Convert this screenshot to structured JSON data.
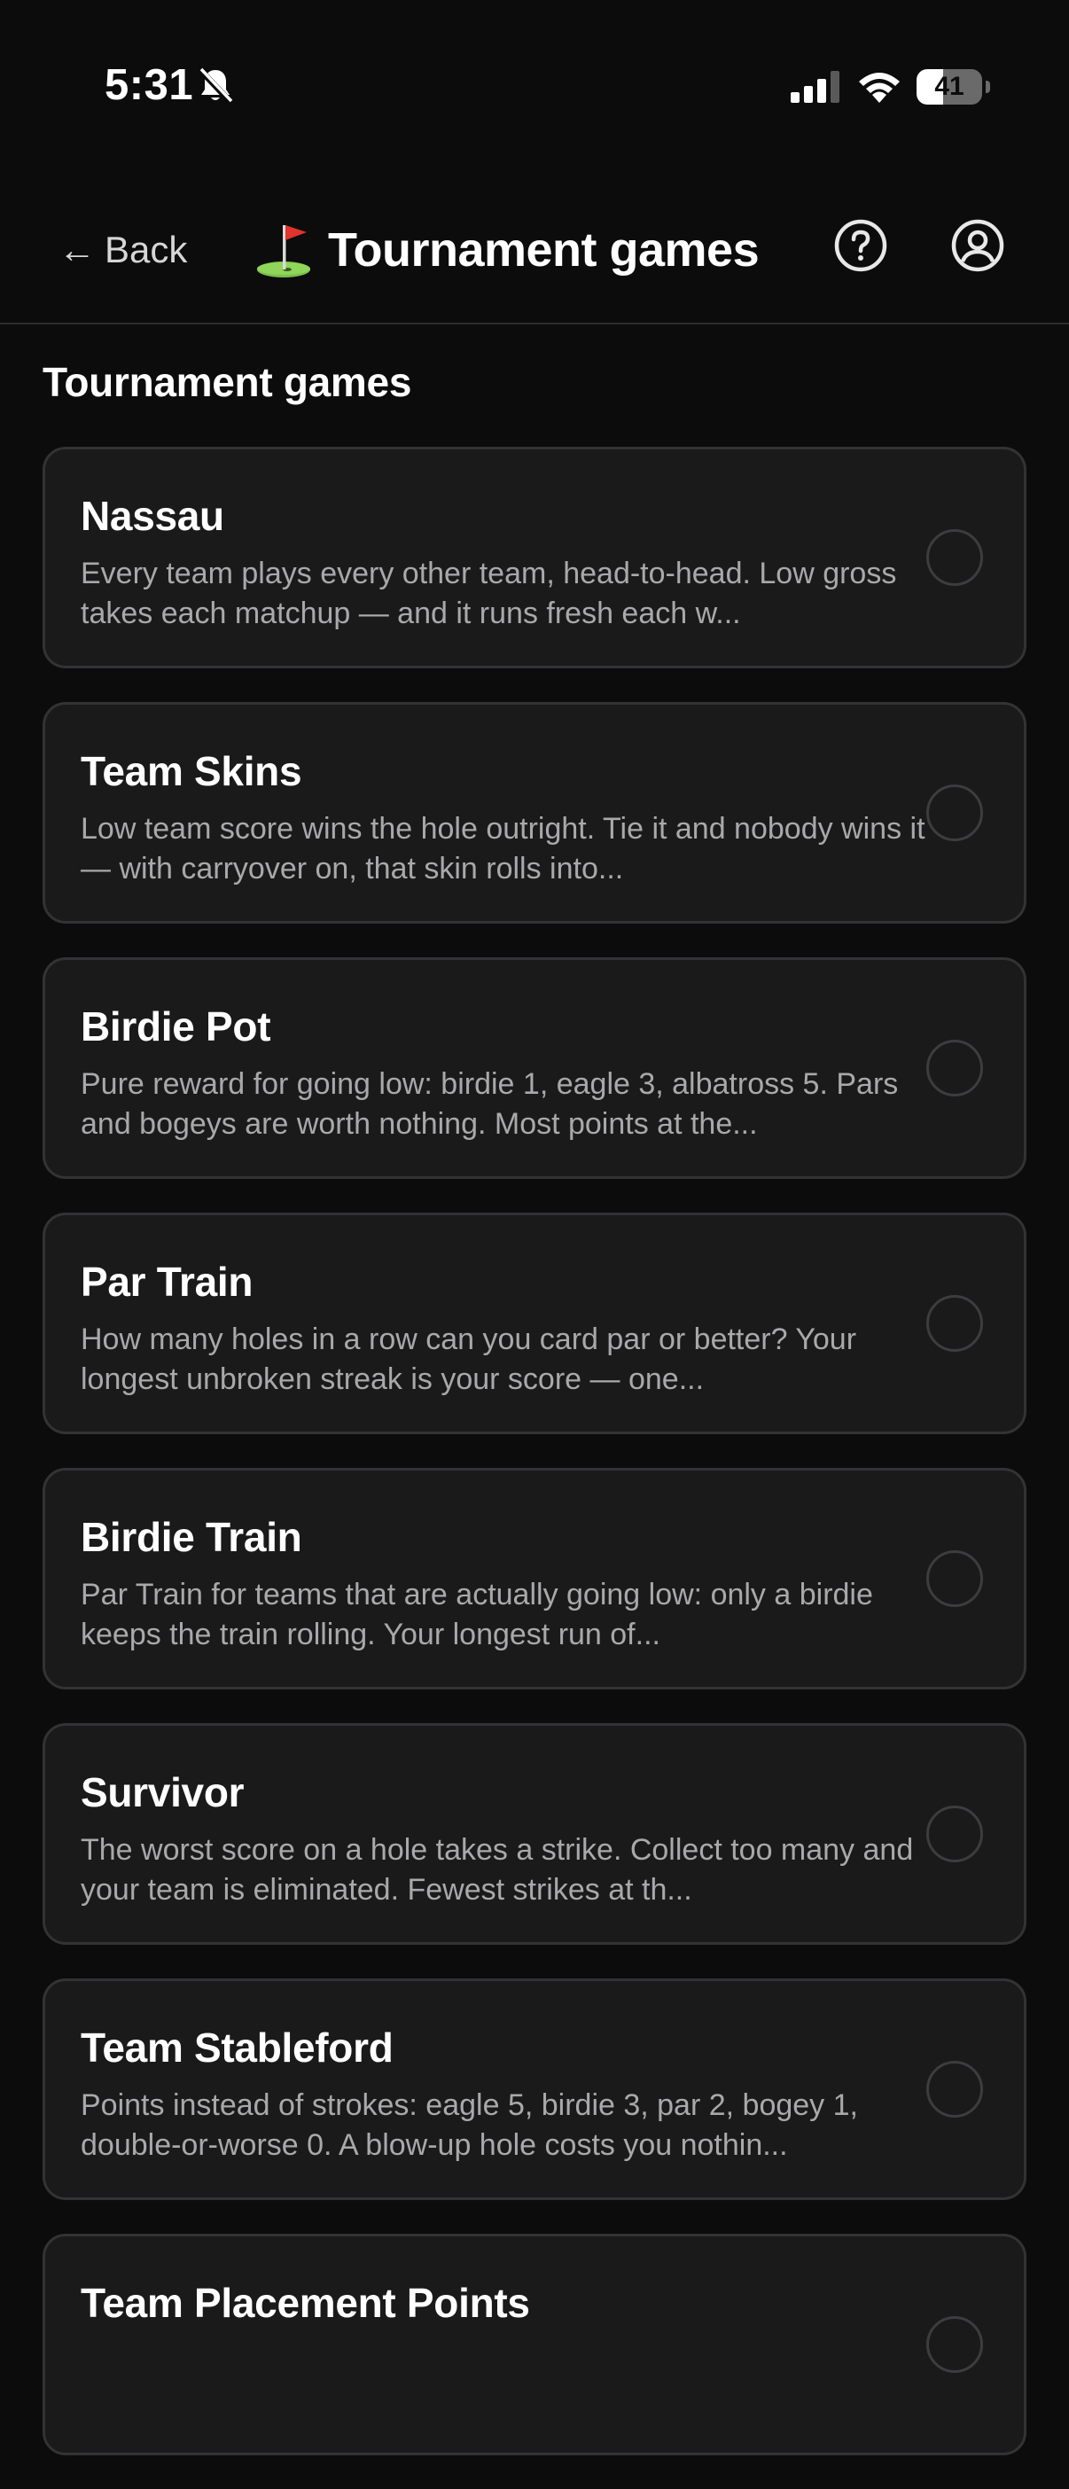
{
  "status_bar": {
    "time": "5:31",
    "battery_level": "41",
    "battery_fraction": 0.41
  },
  "header": {
    "back_label": "Back",
    "back_arrow": "←",
    "title": "Tournament games",
    "title_icon": "golf-flag-icon",
    "help_icon": "help-circle-icon",
    "account_icon": "account-circle-icon"
  },
  "section": {
    "title": "Tournament games"
  },
  "games": [
    {
      "name": "Nassau",
      "description": "Every team plays every other team, head-to-head. Low gross takes each matchup — and it runs fresh each w...",
      "selected": false
    },
    {
      "name": "Team Skins",
      "description": "Low team score wins the hole outright. Tie it and nobody wins it — with carryover on, that skin rolls into...",
      "selected": false
    },
    {
      "name": "Birdie Pot",
      "description": "Pure reward for going low: birdie 1, eagle 3, albatross 5. Pars and bogeys are worth nothing. Most points at the...",
      "selected": false
    },
    {
      "name": "Par Train",
      "description": "How many holes in a row can you card par or better? Your longest unbroken streak is your score — one...",
      "selected": false
    },
    {
      "name": "Birdie Train",
      "description": "Par Train for teams that are actually going low: only a birdie keeps the train rolling. Your longest run of...",
      "selected": false
    },
    {
      "name": "Survivor",
      "description": "The worst score on a hole takes a strike. Collect too many and your team is eliminated. Fewest strikes at th...",
      "selected": false
    },
    {
      "name": "Team Stableford",
      "description": "Points instead of strokes: eagle 5, birdie 3, par 2, bogey 1, double-or-worse 0. A blow-up hole costs you nothin...",
      "selected": false
    },
    {
      "name": "Team Placement Points",
      "description": "",
      "selected": false
    }
  ],
  "colors": {
    "background": "#0c0c0d",
    "card": "#1a1a1b",
    "card_border": "#333335",
    "text_primary": "#ffffff",
    "text_secondary": "#a9a9ab"
  }
}
